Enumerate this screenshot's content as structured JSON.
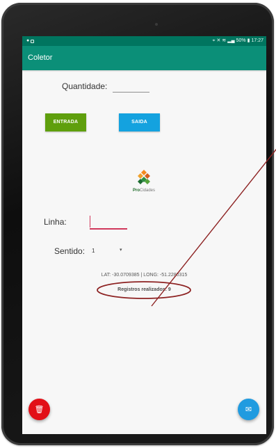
{
  "status_bar": {
    "right_text": "50%",
    "time": "17:27"
  },
  "app": {
    "title": "Coletor"
  },
  "form": {
    "quantidade_label": "Quantidade:",
    "linha_label": "Linha:",
    "sentido_label": "Sentido:",
    "sentido_selected": "1"
  },
  "actions": {
    "entrada": "ENTRADA",
    "saida": "SAIDA"
  },
  "logo": {
    "pro": "Pro",
    "cidades": "Cidades"
  },
  "location": {
    "text": "LAT: -30.0709385 | LONG: -51.2280315"
  },
  "records": {
    "text": "Registros realizados: 9"
  },
  "icons": {
    "status_left": [
      "notification-icon",
      "gallery-icon"
    ],
    "status_right": [
      "location-icon",
      "mute-icon",
      "wifi-icon",
      "signal-icon",
      "battery-icon"
    ],
    "fab_left": "trash-icon",
    "fab_right": "mail-icon",
    "logo": "procidades-logo-icon"
  },
  "colors": {
    "status_bar": "#00755f",
    "app_bar": "#0b8f78",
    "entrada_button": "#5f9f0d",
    "saida_button": "#14a2df",
    "focused_field": "#d0375b",
    "trash_fab": "#e20f17",
    "mail_fab": "#209be0",
    "annotation": "#8d2222"
  }
}
